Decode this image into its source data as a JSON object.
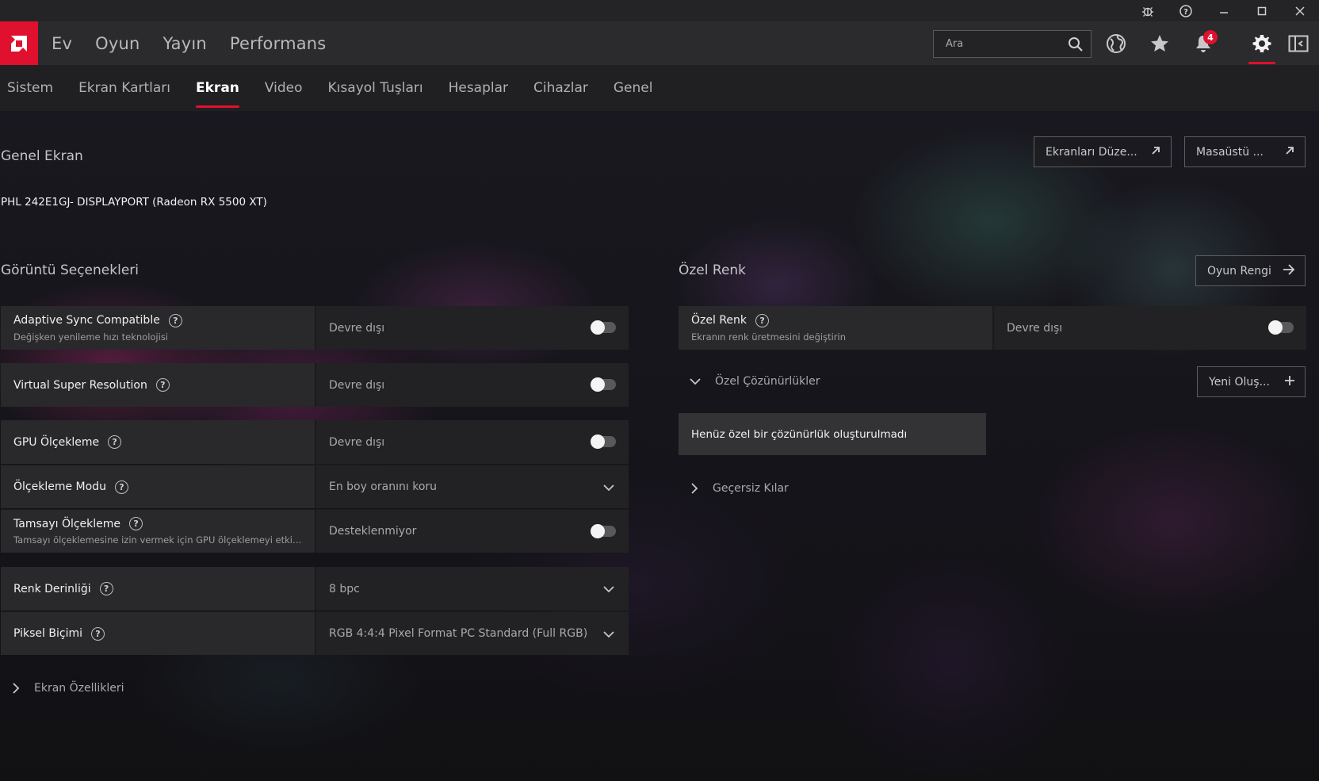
{
  "topnav": {
    "items": [
      "Ev",
      "Oyun",
      "Yayın",
      "Performans"
    ],
    "search_placeholder": "Ara",
    "notification_count": "4"
  },
  "subnav": {
    "items": [
      "Sistem",
      "Ekran Kartları",
      "Ekran",
      "Video",
      "Kısayol Tuşları",
      "Hesaplar",
      "Cihazlar",
      "Genel"
    ],
    "active": "Ekran"
  },
  "header": {
    "title": "Genel Ekran",
    "monitor": "PHL 242E1GJ- DISPLAYPORT (Radeon RX 5500 XT)",
    "btn_displays": "Ekranları Düze...",
    "btn_desktop": "Masaüstü ..."
  },
  "display_options": {
    "title": "Görüntü Seçenekleri",
    "rows": [
      {
        "name": "Adaptive Sync Compatible",
        "sub": "Değişken yenileme hızı teknolojisi",
        "value": "Devre dışı"
      },
      {
        "name": "Virtual Super Resolution",
        "value": "Devre dışı"
      },
      {
        "name": "GPU Ölçekleme",
        "value": "Devre dışı"
      },
      {
        "name": "Ölçekleme Modu",
        "value": "En boy oranını koru"
      },
      {
        "name": "Tamsayı Ölçekleme",
        "sub": "Tamsayı ölçeklemesine izin vermek için GPU ölçeklemeyi etkin...",
        "value": "Desteklenmiyor"
      },
      {
        "name": "Renk Derinliği",
        "value": "8 bpc"
      },
      {
        "name": "Piksel Biçimi",
        "value": "RGB 4:4:4 Pixel Format PC Standard (Full RGB)"
      }
    ],
    "expand_label": "Ekran Özellikleri"
  },
  "custom_color": {
    "title": "Özel Renk",
    "btn_game_color": "Oyun Rengi",
    "row": {
      "name": "Özel Renk",
      "sub": "Ekranın renk üretmesini değiştirin",
      "value": "Devre dışı"
    },
    "custom_res_label": "Özel Çözünürlükler",
    "btn_new": "Yeni Oluş...",
    "empty_text": "Henüz özel bir çözünürlük oluşturulmadı",
    "overrides_label": "Geçersiz Kılar"
  },
  "colors": {
    "accent": "#e0102f"
  }
}
